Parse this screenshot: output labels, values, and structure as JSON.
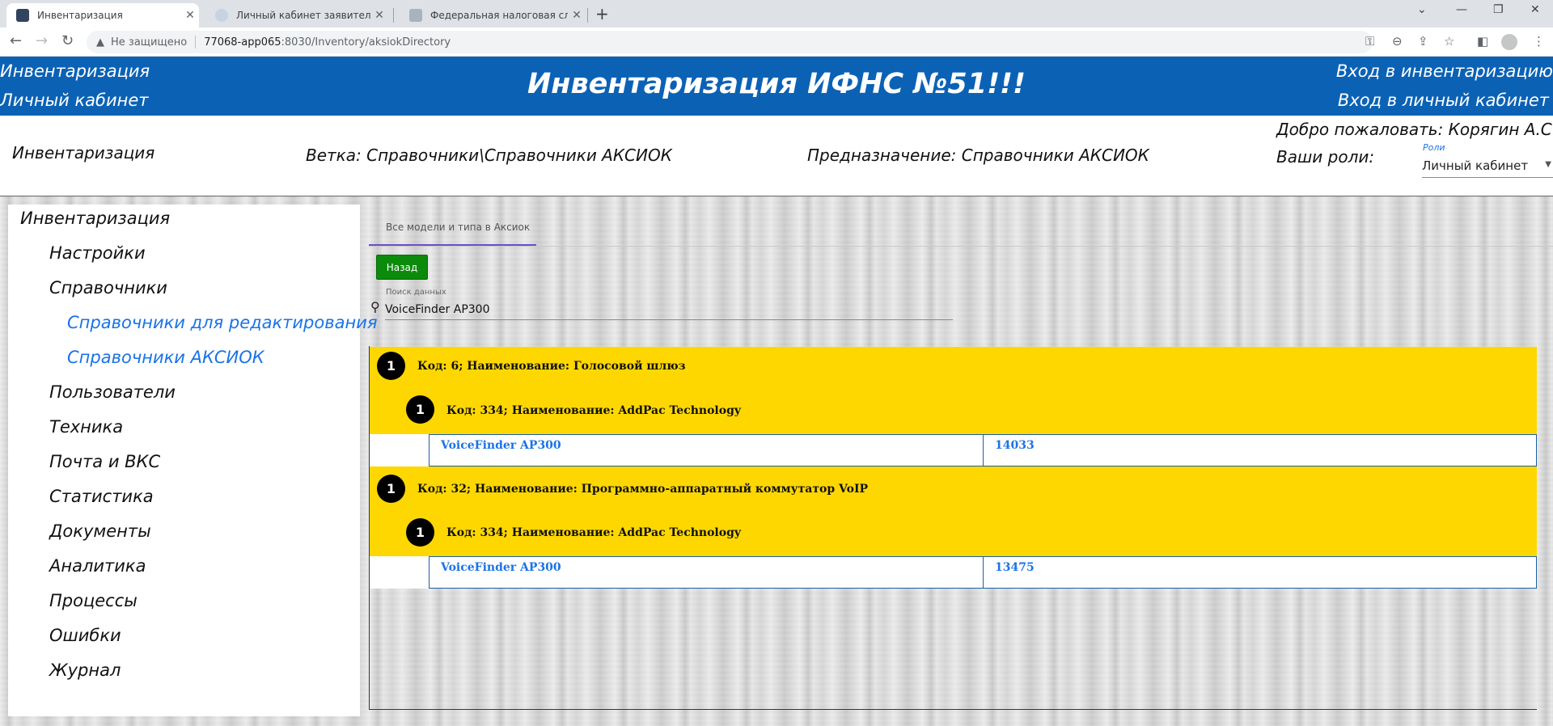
{
  "browser": {
    "tabs": [
      {
        "title": "Инвентаризация",
        "active": true
      },
      {
        "title": "Личный кабинет заявителя",
        "active": false
      },
      {
        "title": "Федеральная налоговая служба",
        "active": false
      }
    ],
    "new_tab": "+",
    "address": {
      "security_label": "Не защищено",
      "host": "77068-app065",
      "path": ":8030/Inventory/aksiokDirectory"
    }
  },
  "header": {
    "left_links": [
      "Инвентаризация",
      "Личный кабинет"
    ],
    "title": "Инвентаризация ИФНС №51!!!",
    "right_links": [
      "Вход в инвентаризацию",
      "Вход в личный кабинет"
    ]
  },
  "info": {
    "section": "Инвентаризация",
    "branch": "Ветка: Справочники\\Справочники АКСИОК",
    "purpose": "Предназначение: Справочники АКСИОК",
    "welcome": "Добро пожаловать: Корягин А.С.",
    "roles_label": "Ваши роли:",
    "roles_field_label": "Роли",
    "roles_value": "Личный кабинет"
  },
  "sidebar": {
    "items": [
      {
        "label": "Инвентаризация"
      },
      {
        "label": "Настройки"
      },
      {
        "label": "Справочники"
      },
      {
        "label": "Справочники для редактирования"
      },
      {
        "label": "Справочники АКСИОК"
      },
      {
        "label": "Пользователи"
      },
      {
        "label": "Техника"
      },
      {
        "label": "Почта и ВКС"
      },
      {
        "label": "Статистика"
      },
      {
        "label": "Документы"
      },
      {
        "label": "Аналитика"
      },
      {
        "label": "Процессы"
      },
      {
        "label": "Ошибки"
      },
      {
        "label": "Журнал"
      }
    ]
  },
  "content": {
    "tab_label": "Все модели и типа в Аксиок",
    "back_button": "Назад",
    "search_label": "Поиск данных",
    "search_value": "VoiceFinder AP300",
    "groups": [
      {
        "badge": "1",
        "text": "Код: 6; Наименование: Голосовой шлюз",
        "sub_badge": "1",
        "sub_text": "Код: 334; Наименование: AddPac Technology",
        "row": {
          "model": "VoiceFinder AP300",
          "code": "14033"
        }
      },
      {
        "badge": "1",
        "text": "Код: 32; Наименование: Программно-аппаратный коммутатор VoIP",
        "sub_badge": "1",
        "sub_text": "Код: 334; Наименование: AddPac Technology",
        "row": {
          "model": "VoiceFinder AP300",
          "code": "13475"
        }
      }
    ]
  }
}
